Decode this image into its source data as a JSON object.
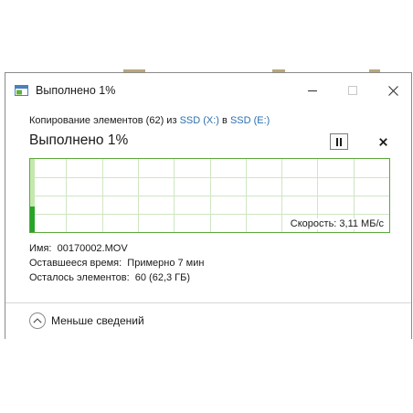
{
  "window": {
    "title": "Выполнено 1%",
    "controls": {
      "minimize": "—",
      "maximize": "☐",
      "close": "✕"
    }
  },
  "copy": {
    "subtitle_prefix": "Копирование элементов (62) из ",
    "source": "SSD (X:)",
    "subtitle_middle": " в ",
    "destination": "SSD (E:)",
    "progress_heading": "Выполнено 1%",
    "progress_fraction": 0.01,
    "speed": "Скорость: 3,11 МБ/с"
  },
  "details": {
    "name_label": "Имя:",
    "name_value": "00170002.MOV",
    "time_label": "Оставшееся время:",
    "time_value": "Примерно 7 мин",
    "items_label": "Осталось элементов:",
    "items_value": "60 (62,3 ГБ)"
  },
  "footer": {
    "less_details": "Меньше сведений"
  },
  "colors": {
    "accent_green": "#5aa83a",
    "fill_green": "#c4e8ae",
    "bar_green": "#28a428",
    "grid": "#cfe6c2",
    "link": "#2a6fb0"
  }
}
